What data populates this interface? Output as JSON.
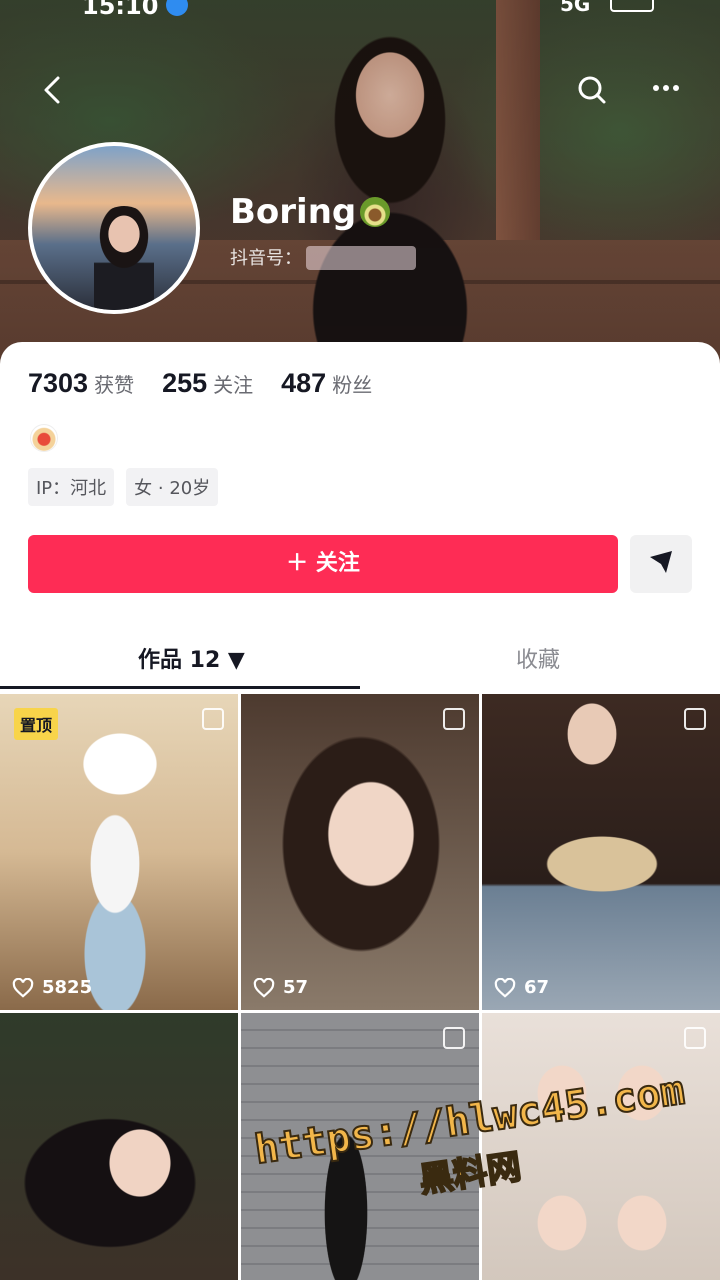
{
  "status_bar": {
    "time": "15:10",
    "network": "5G"
  },
  "profile": {
    "name": "Boring",
    "douyin_id_label": "抖音号："
  },
  "stats": [
    {
      "value": "7303",
      "label": "获赞"
    },
    {
      "value": "255",
      "label": "关注"
    },
    {
      "value": "487",
      "label": "粉丝"
    }
  ],
  "tags": [
    "IP：河北",
    "女 · 20岁"
  ],
  "actions": {
    "follow_label": "＋ 关注"
  },
  "tabs": [
    {
      "label": "作品 12 ▼",
      "active": true
    },
    {
      "label": "收藏",
      "active": false
    }
  ],
  "grid": [
    {
      "likes": "5825",
      "pinned": "置顶"
    },
    {
      "likes": "57"
    },
    {
      "likes": "67"
    },
    {
      "likes": ""
    },
    {
      "likes": ""
    },
    {
      "likes": ""
    }
  ],
  "watermark": {
    "url": "https://hlwc45.com",
    "text": "黑料网"
  },
  "colors": {
    "accent": "#fe2c55",
    "pinned": "#f8d44a"
  }
}
